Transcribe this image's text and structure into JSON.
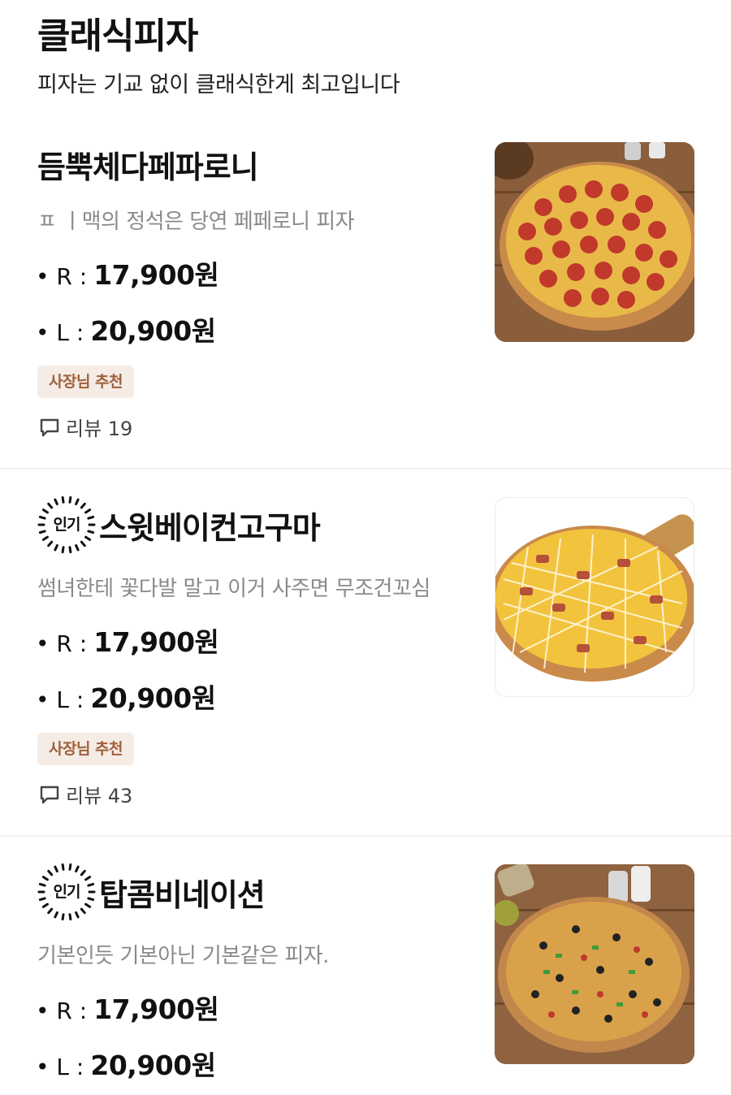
{
  "section": {
    "title": "클래식피자",
    "subtitle": "피자는 기교 없이 클래식한게 최고입니다"
  },
  "items": [
    {
      "name": "듬뿍체다페파로니",
      "popular": false,
      "description": "ㅍ ㅣ맥의 정석은 당연 페페로니 피자",
      "prices": [
        {
          "size": "• R :",
          "price": "17,900원"
        },
        {
          "size": "• L :",
          "price": "20,900원"
        }
      ],
      "owner_badge": "사장님 추천",
      "reviews": "리뷰 19",
      "image_icon": "pepperoni-pizza-image"
    },
    {
      "name": "스윗베이컨고구마",
      "popular": true,
      "popular_label": "인기",
      "description": "썸녀한테 꽃다발 말고 이거 사주면 무조건꼬심",
      "prices": [
        {
          "size": "• R :",
          "price": "17,900원"
        },
        {
          "size": "• L :",
          "price": "20,900원"
        }
      ],
      "owner_badge": "사장님 추천",
      "reviews": "리뷰 43",
      "image_icon": "sweet-potato-bacon-pizza-image"
    },
    {
      "name": "탑콤비네이션",
      "popular": true,
      "popular_label": "인기",
      "description": "기본인듯 기본아닌 기본같은 피자.",
      "prices": [
        {
          "size": "• R :",
          "price": "17,900원"
        },
        {
          "size": "• L :",
          "price": "20,900원"
        }
      ],
      "image_icon": "combination-pizza-image"
    }
  ],
  "colors": {
    "badge_bg": "#f4ece5",
    "badge_text": "#a15f3b",
    "desc_text": "#8a8a8a",
    "divider": "#f1f1f1"
  }
}
